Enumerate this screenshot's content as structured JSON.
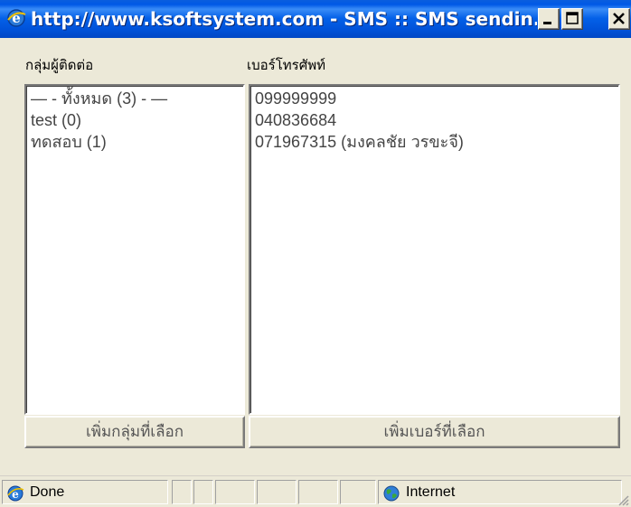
{
  "window": {
    "title": "http://www.ksoftsystem.com - SMS :: SMS sendin...",
    "icon": "ie-icon",
    "accent": "#0058e6"
  },
  "groups": {
    "header": "กลุ่มผู้ติดต่อ",
    "items": [
      "— - ทั้งหมด (3) - —",
      "test (0)",
      "ทดสอบ (1)"
    ],
    "add_button": "เพิ่มกลุ่มที่เลือก"
  },
  "phones": {
    "header": "เบอร์โทรศัพท์",
    "items": [
      "099999999",
      "040836684",
      "071967315 (มงคลชัย วรขะจี)"
    ],
    "add_button": "เพิ่มเบอร์ที่เลือก"
  },
  "status": {
    "text": "Done",
    "zone": "Internet",
    "icons": [
      "ie-page-icon",
      "globe-icon"
    ]
  }
}
